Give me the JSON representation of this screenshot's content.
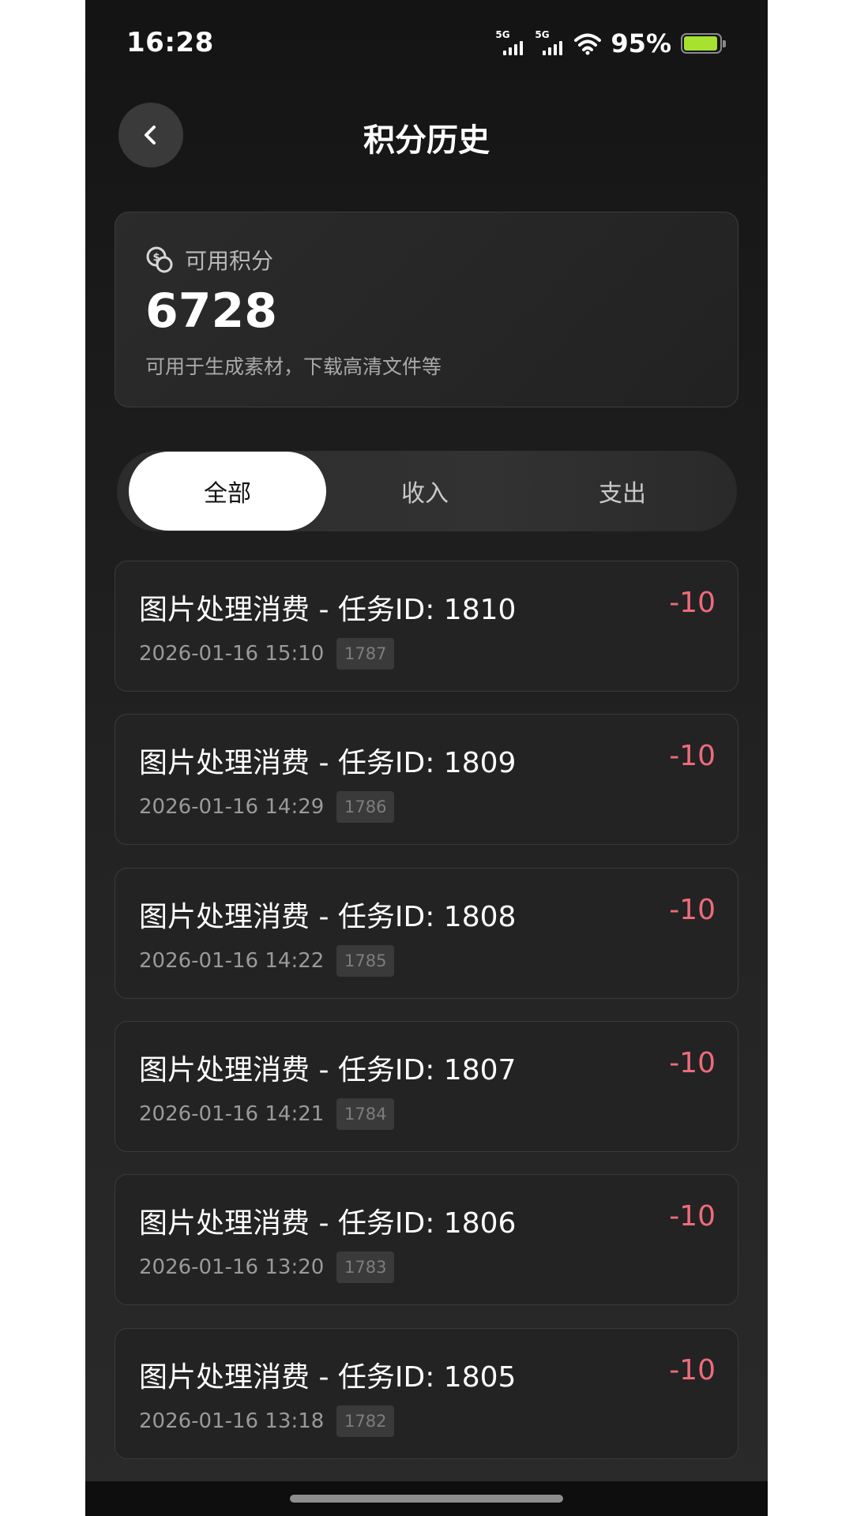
{
  "status_bar": {
    "time": "16:28",
    "signal_1_label": "5G",
    "signal_2_label": "5G",
    "battery_percent": "95%",
    "battery_level": 0.95
  },
  "header": {
    "title": "积分历史",
    "back_icon": "chevron-left-icon"
  },
  "balance": {
    "icon": "coin-icon",
    "label": "可用积分",
    "value": "6728",
    "description": "可用于生成素材，下载高清文件等"
  },
  "tabs": [
    {
      "label": "全部",
      "active": true
    },
    {
      "label": "收入",
      "active": false
    },
    {
      "label": "支出",
      "active": false
    }
  ],
  "records": [
    {
      "title": "图片处理消费 - 任务ID: 1810",
      "amount": "-10",
      "time": "2026-01-16  15:10",
      "tag": "1787"
    },
    {
      "title": "图片处理消费 - 任务ID: 1809",
      "amount": "-10",
      "time": "2026-01-16  14:29",
      "tag": "1786"
    },
    {
      "title": "图片处理消费 - 任务ID: 1808",
      "amount": "-10",
      "time": "2026-01-16  14:22",
      "tag": "1785"
    },
    {
      "title": "图片处理消费 - 任务ID: 1807",
      "amount": "-10",
      "time": "2026-01-16  14:21",
      "tag": "1784"
    },
    {
      "title": "图片处理消费 - 任务ID: 1806",
      "amount": "-10",
      "time": "2026-01-16  13:20",
      "tag": "1783"
    },
    {
      "title": "图片处理消费 - 任务ID: 1805",
      "amount": "-10",
      "time": "2026-01-16  13:18",
      "tag": "1782"
    }
  ],
  "colors": {
    "negative_amount": "#ee6b7a",
    "battery": "#a6e22e",
    "active_tab_bg": "#ffffff"
  }
}
